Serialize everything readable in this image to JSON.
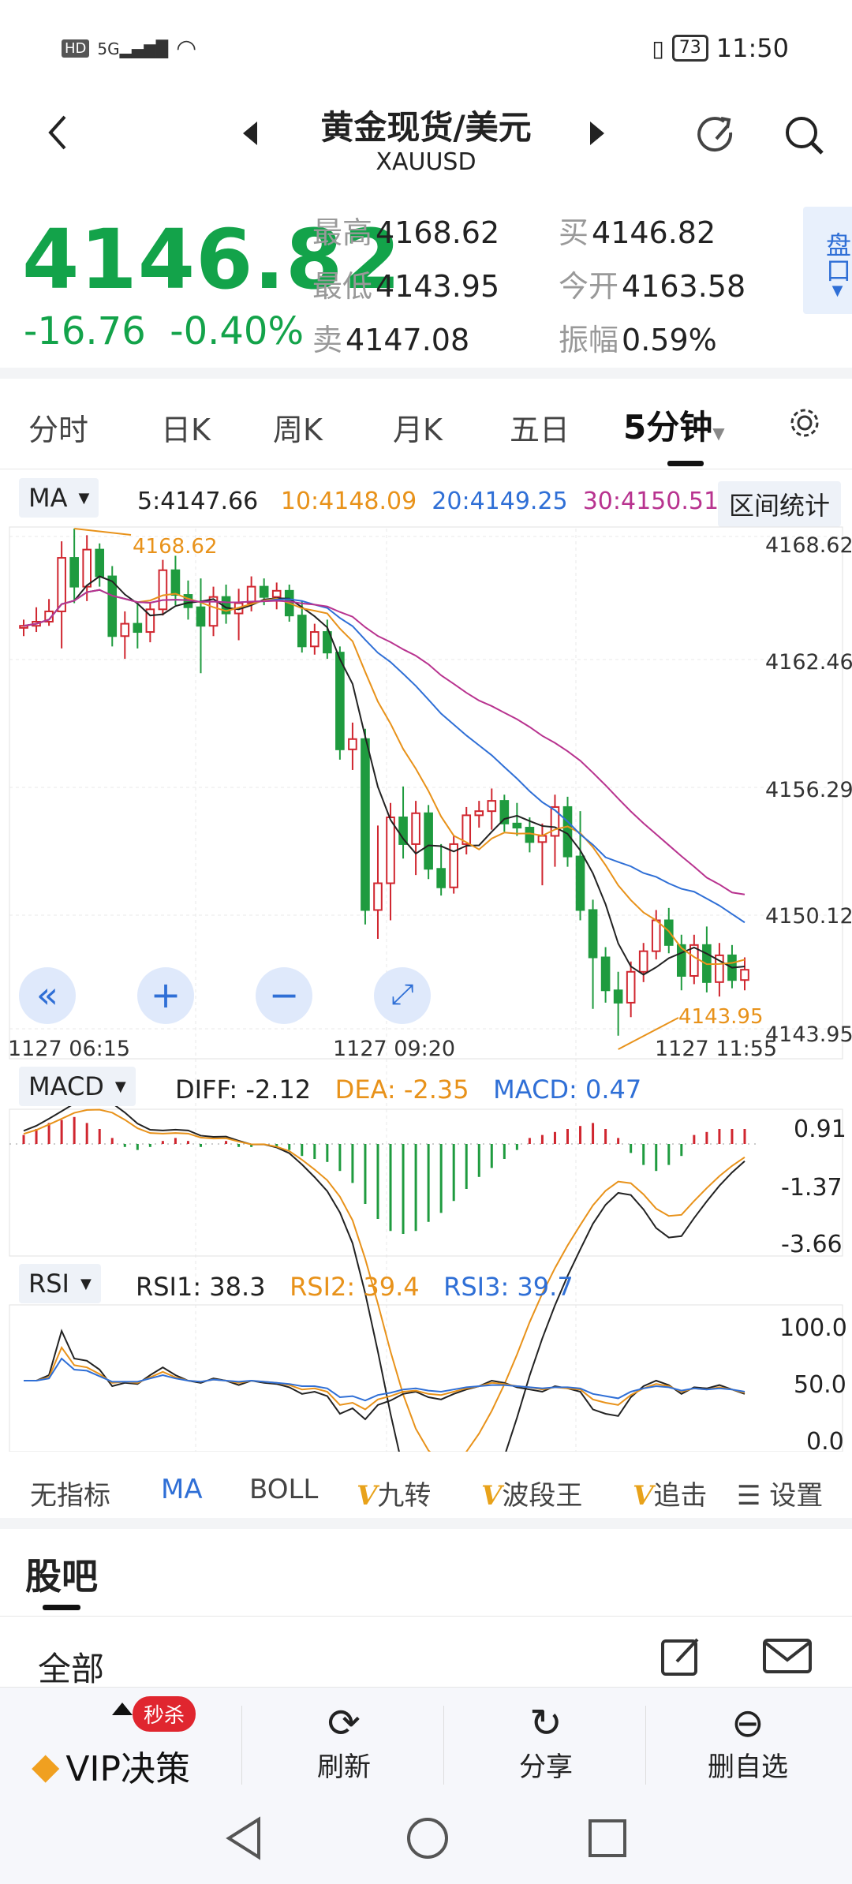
{
  "status_bar": {
    "left_icons": [
      "HD",
      "5G"
    ],
    "battery": "73",
    "time": "11:50"
  },
  "header": {
    "title": "黄金现货/美元",
    "symbol": "XAUUSD"
  },
  "quote": {
    "price": "4146.82",
    "change": "-16.76",
    "change_pct": "-0.40%",
    "high_label": "最高",
    "high": "4168.62",
    "low_label": "最低",
    "low": "4143.95",
    "sell_label": "卖",
    "sell": "4147.08",
    "buy_label": "买",
    "buy": "4146.82",
    "open_label": "今开",
    "open": "4163.58",
    "amp_label": "振幅",
    "amp": "0.59%",
    "pankou_label": "盘口"
  },
  "period_tabs": [
    "分时",
    "日K",
    "周K",
    "月K",
    "五日",
    "5分钟"
  ],
  "period_active": "5分钟",
  "ma": {
    "label": "MA",
    "ma5": "5:4147.66",
    "ma10": "10:4148.09",
    "ma20": "20:4149.25",
    "ma30": "30:4150.51",
    "range_btn": "区间统计"
  },
  "price_axis": [
    "4168.62",
    "4162.46",
    "4156.29",
    "4150.12",
    "4143.95"
  ],
  "time_axis": [
    "1127  06:15",
    "1127  09:20",
    "1127  11:55"
  ],
  "high_marker": "4168.62",
  "low_marker": "4143.95",
  "macd": {
    "label": "MACD",
    "diff": "DIFF: -2.12",
    "dea": "DEA: -2.35",
    "macd": "MACD: 0.47",
    "axis": [
      "0.91",
      "-1.37",
      "-3.66"
    ]
  },
  "rsi": {
    "label": "RSI",
    "rsi1": "RSI1: 38.3",
    "rsi2": "RSI2: 39.4",
    "rsi3": "RSI3: 39.7",
    "axis": [
      "100.0",
      "50.0",
      "0.0"
    ]
  },
  "indicator_tabs": {
    "none": "无指标",
    "ma": "MA",
    "boll": "BOLL",
    "jiuzhuan": "九转",
    "boduan": "波段王",
    "zhuiji": "追击",
    "settings": "设置",
    "v": "V"
  },
  "guba": {
    "title": "股吧",
    "all": "全部"
  },
  "bottom_nav": {
    "vip": "VIP决策",
    "badge": "秒杀",
    "refresh": "刷新",
    "share": "分享",
    "remove": "删自选"
  },
  "colors": {
    "up": "#d0262f",
    "down": "#1f9b3f",
    "ma5": "#222222",
    "ma10": "#e8921a",
    "ma20": "#2f6fd6",
    "ma30": "#b8338f",
    "accent": "#2f6fd6"
  },
  "chart_data": {
    "type": "candlestick",
    "price_range": [
      4143.95,
      4168.62
    ],
    "candles_ohlc": [
      [
        4163.8,
        4164.2,
        4163.4,
        4163.9
      ],
      [
        4163.9,
        4164.8,
        4163.6,
        4164.1
      ],
      [
        4164.1,
        4165.2,
        4163.9,
        4164.6
      ],
      [
        4164.6,
        4168.0,
        4162.8,
        4167.2
      ],
      [
        4167.2,
        4168.62,
        4165.0,
        4165.8
      ],
      [
        4165.8,
        4168.3,
        4165.1,
        4167.6
      ],
      [
        4167.6,
        4167.9,
        4165.8,
        4166.3
      ],
      [
        4166.3,
        4166.8,
        4162.9,
        4163.4
      ],
      [
        4163.4,
        4164.6,
        4162.3,
        4164.0
      ],
      [
        4164.0,
        4165.0,
        4162.8,
        4163.6
      ],
      [
        4163.6,
        4165.0,
        4163.1,
        4164.7
      ],
      [
        4164.7,
        4167.1,
        4164.4,
        4166.6
      ],
      [
        4166.6,
        4167.3,
        4164.9,
        4165.4
      ],
      [
        4165.4,
        4166.1,
        4164.2,
        4164.8
      ],
      [
        4164.8,
        4166.2,
        4161.6,
        4163.9
      ],
      [
        4163.9,
        4165.8,
        4163.4,
        4165.3
      ],
      [
        4165.3,
        4165.9,
        4164.0,
        4164.5
      ],
      [
        4164.5,
        4165.7,
        4163.2,
        4165.0
      ],
      [
        4165.0,
        4166.3,
        4164.6,
        4165.8
      ],
      [
        4165.8,
        4166.2,
        4164.9,
        4165.3
      ],
      [
        4165.3,
        4166.0,
        4164.7,
        4165.6
      ],
      [
        4165.6,
        4165.9,
        4164.1,
        4164.4
      ],
      [
        4164.4,
        4165.1,
        4162.6,
        4162.9
      ],
      [
        4162.9,
        4164.0,
        4162.5,
        4163.6
      ],
      [
        4163.6,
        4164.2,
        4162.3,
        4162.6
      ],
      [
        4162.6,
        4162.9,
        4157.4,
        4157.9
      ],
      [
        4157.9,
        4159.2,
        4156.9,
        4158.4
      ],
      [
        4158.4,
        4158.9,
        4149.4,
        4150.1
      ],
      [
        4150.1,
        4154.2,
        4148.7,
        4151.4
      ],
      [
        4151.4,
        4155.3,
        4149.6,
        4154.6
      ],
      [
        4154.6,
        4156.1,
        4152.6,
        4153.3
      ],
      [
        4153.3,
        4155.4,
        4151.8,
        4154.8
      ],
      [
        4154.8,
        4155.2,
        4151.6,
        4152.1
      ],
      [
        4152.1,
        4153.3,
        4150.8,
        4151.2
      ],
      [
        4151.2,
        4153.7,
        4150.9,
        4153.3
      ],
      [
        4153.3,
        4155.1,
        4152.8,
        4154.7
      ],
      [
        4154.7,
        4155.4,
        4154.1,
        4154.9
      ],
      [
        4154.9,
        4156.0,
        4154.0,
        4155.4
      ],
      [
        4155.4,
        4155.7,
        4153.9,
        4154.3
      ],
      [
        4154.3,
        4155.3,
        4153.7,
        4154.1
      ],
      [
        4154.1,
        4154.6,
        4152.9,
        4153.4
      ],
      [
        4153.4,
        4154.3,
        4151.3,
        4153.7
      ],
      [
        4153.7,
        4155.7,
        4152.2,
        4155.1
      ],
      [
        4155.1,
        4155.6,
        4152.2,
        4152.7
      ],
      [
        4152.7,
        4154.9,
        4149.6,
        4150.1
      ],
      [
        4150.1,
        4150.6,
        4145.3,
        4147.8
      ],
      [
        4147.8,
        4148.3,
        4145.6,
        4146.2
      ],
      [
        4146.2,
        4147.1,
        4144.0,
        4145.6
      ],
      [
        4145.6,
        4147.6,
        4144.9,
        4147.1
      ],
      [
        4147.1,
        4148.5,
        4146.6,
        4148.1
      ],
      [
        4148.1,
        4150.1,
        4147.7,
        4149.6
      ],
      [
        4149.6,
        4150.2,
        4148.0,
        4148.4
      ],
      [
        4148.4,
        4148.9,
        4146.2,
        4146.9
      ],
      [
        4146.9,
        4148.9,
        4146.5,
        4148.4
      ],
      [
        4148.4,
        4149.3,
        4146.1,
        4146.6
      ],
      [
        4146.6,
        4148.5,
        4145.9,
        4147.9
      ],
      [
        4147.9,
        4148.4,
        4146.3,
        4146.7
      ],
      [
        4146.7,
        4147.8,
        4146.2,
        4147.2
      ]
    ],
    "macd_hist": [
      0.3,
      0.5,
      0.7,
      0.8,
      0.9,
      0.7,
      0.5,
      0.2,
      -0.1,
      -0.2,
      -0.1,
      0.1,
      0.2,
      0.1,
      -0.1,
      0.0,
      0.1,
      -0.1,
      -0.1,
      0.0,
      -0.1,
      -0.2,
      -0.4,
      -0.5,
      -0.6,
      -0.9,
      -1.3,
      -2.0,
      -2.5,
      -2.9,
      -3.0,
      -2.9,
      -2.6,
      -2.3,
      -1.9,
      -1.5,
      -1.1,
      -0.8,
      -0.5,
      -0.2,
      0.2,
      0.3,
      0.4,
      0.5,
      0.6,
      0.7,
      0.5,
      0.2,
      -0.3,
      -0.7,
      -0.9,
      -0.7,
      -0.4,
      0.3,
      0.4,
      0.5,
      0.5,
      0.5
    ],
    "rsi1": [
      50,
      50,
      55,
      95,
      70,
      68,
      60,
      45,
      48,
      47,
      55,
      62,
      55,
      50,
      48,
      52,
      50,
      46,
      50,
      48,
      47,
      44,
      38,
      40,
      36,
      20,
      25,
      15,
      28,
      32,
      38,
      40,
      35,
      33,
      38,
      42,
      45,
      50,
      48,
      44,
      42,
      40,
      45,
      43,
      40,
      24,
      20,
      18,
      35,
      45,
      50,
      46,
      38,
      44,
      43,
      46,
      42,
      38
    ],
    "rsi2": [
      50,
      50,
      53,
      80,
      64,
      62,
      56,
      48,
      49,
      48,
      53,
      58,
      53,
      50,
      49,
      51,
      50,
      48,
      50,
      49,
      48,
      46,
      42,
      43,
      40,
      28,
      30,
      24,
      33,
      36,
      40,
      41,
      38,
      37,
      40,
      43,
      45,
      48,
      47,
      45,
      44,
      42,
      44,
      43,
      42,
      33,
      30,
      28,
      37,
      43,
      47,
      45,
      40,
      43,
      42,
      44,
      42,
      39
    ],
    "rsi3": [
      50,
      50,
      52,
      70,
      60,
      59,
      54,
      49,
      49,
      49,
      52,
      55,
      52,
      50,
      49,
      51,
      50,
      49,
      50,
      49,
      48,
      47,
      45,
      45,
      43,
      35,
      36,
      32,
      37,
      39,
      42,
      43,
      41,
      40,
      42,
      44,
      45,
      46,
      46,
      45,
      44,
      43,
      44,
      44,
      43,
      38,
      36,
      34,
      40,
      43,
      45,
      44,
      41,
      43,
      42,
      43,
      42,
      40
    ]
  }
}
